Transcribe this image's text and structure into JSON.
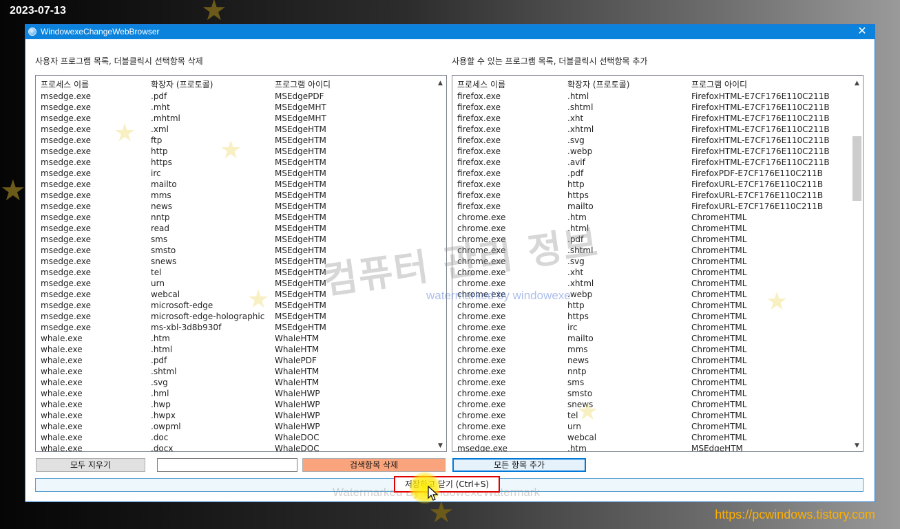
{
  "desktop": {
    "date": "2023-07-13",
    "blog_url": "https://pcwindows.tistory.com"
  },
  "window": {
    "title": "WindowexeChangeWebBrowser",
    "close_glyph": "✕"
  },
  "left_panel": {
    "label": "사용자 프로그램 목록, 더블클릭시 선택항목 삭제",
    "headers": [
      "프로세스 이름",
      "확장자 (프로토콜)",
      "프로그램 아이디"
    ],
    "rows": [
      [
        "msedge.exe",
        ".pdf",
        "MSEdgePDF"
      ],
      [
        "msedge.exe",
        ".mht",
        "MSEdgeMHT"
      ],
      [
        "msedge.exe",
        ".mhtml",
        "MSEdgeMHT"
      ],
      [
        "msedge.exe",
        ".xml",
        "MSEdgeHTM"
      ],
      [
        "msedge.exe",
        "ftp",
        "MSEdgeHTM"
      ],
      [
        "msedge.exe",
        "http",
        "MSEdgeHTM"
      ],
      [
        "msedge.exe",
        "https",
        "MSEdgeHTM"
      ],
      [
        "msedge.exe",
        "irc",
        "MSEdgeHTM"
      ],
      [
        "msedge.exe",
        "mailto",
        "MSEdgeHTM"
      ],
      [
        "msedge.exe",
        "mms",
        "MSEdgeHTM"
      ],
      [
        "msedge.exe",
        "news",
        "MSEdgeHTM"
      ],
      [
        "msedge.exe",
        "nntp",
        "MSEdgeHTM"
      ],
      [
        "msedge.exe",
        "read",
        "MSEdgeHTM"
      ],
      [
        "msedge.exe",
        "sms",
        "MSEdgeHTM"
      ],
      [
        "msedge.exe",
        "smsto",
        "MSEdgeHTM"
      ],
      [
        "msedge.exe",
        "snews",
        "MSEdgeHTM"
      ],
      [
        "msedge.exe",
        "tel",
        "MSEdgeHTM"
      ],
      [
        "msedge.exe",
        "urn",
        "MSEdgeHTM"
      ],
      [
        "msedge.exe",
        "webcal",
        "MSEdgeHTM"
      ],
      [
        "msedge.exe",
        "microsoft-edge",
        "MSEdgeHTM"
      ],
      [
        "msedge.exe",
        "microsoft-edge-holographic",
        "MSEdgeHTM"
      ],
      [
        "msedge.exe",
        "ms-xbl-3d8b930f",
        "MSEdgeHTM"
      ],
      [
        "whale.exe",
        ".htm",
        "WhaleHTM"
      ],
      [
        "whale.exe",
        ".html",
        "WhaleHTM"
      ],
      [
        "whale.exe",
        ".pdf",
        "WhalePDF"
      ],
      [
        "whale.exe",
        ".shtml",
        "WhaleHTM"
      ],
      [
        "whale.exe",
        ".svg",
        "WhaleHTM"
      ],
      [
        "whale.exe",
        ".hml",
        "WhaleHWP"
      ],
      [
        "whale.exe",
        ".hwp",
        "WhaleHWP"
      ],
      [
        "whale.exe",
        ".hwpx",
        "WhaleHWP"
      ],
      [
        "whale.exe",
        ".owpml",
        "WhaleHWP"
      ],
      [
        "whale.exe",
        ".doc",
        "WhaleDOC"
      ],
      [
        "whale.exe",
        ".docx",
        "WhaleDOC"
      ]
    ]
  },
  "right_panel": {
    "label": "사용할 수 있는 프로그램 목록, 더블클릭시 선택항목 추가",
    "headers": [
      "프로세스 이름",
      "확장자 (프로토콜)",
      "프로그램 아이디"
    ],
    "rows": [
      [
        "firefox.exe",
        ".html",
        "FirefoxHTML-E7CF176E110C211B"
      ],
      [
        "firefox.exe",
        ".shtml",
        "FirefoxHTML-E7CF176E110C211B"
      ],
      [
        "firefox.exe",
        ".xht",
        "FirefoxHTML-E7CF176E110C211B"
      ],
      [
        "firefox.exe",
        ".xhtml",
        "FirefoxHTML-E7CF176E110C211B"
      ],
      [
        "firefox.exe",
        ".svg",
        "FirefoxHTML-E7CF176E110C211B"
      ],
      [
        "firefox.exe",
        ".webp",
        "FirefoxHTML-E7CF176E110C211B"
      ],
      [
        "firefox.exe",
        ".avif",
        "FirefoxHTML-E7CF176E110C211B"
      ],
      [
        "firefox.exe",
        ".pdf",
        "FirefoxPDF-E7CF176E110C211B"
      ],
      [
        "firefox.exe",
        "http",
        "FirefoxURL-E7CF176E110C211B"
      ],
      [
        "firefox.exe",
        "https",
        "FirefoxURL-E7CF176E110C211B"
      ],
      [
        "firefox.exe",
        "mailto",
        "FirefoxURL-E7CF176E110C211B"
      ],
      [
        "chrome.exe",
        ".htm",
        "ChromeHTML"
      ],
      [
        "chrome.exe",
        ".html",
        "ChromeHTML"
      ],
      [
        "chrome.exe",
        ".pdf",
        "ChromeHTML"
      ],
      [
        "chrome.exe",
        ".shtml",
        "ChromeHTML"
      ],
      [
        "chrome.exe",
        ".svg",
        "ChromeHTML"
      ],
      [
        "chrome.exe",
        ".xht",
        "ChromeHTML"
      ],
      [
        "chrome.exe",
        ".xhtml",
        "ChromeHTML"
      ],
      [
        "chrome.exe",
        ".webp",
        "ChromeHTML"
      ],
      [
        "chrome.exe",
        "http",
        "ChromeHTML"
      ],
      [
        "chrome.exe",
        "https",
        "ChromeHTML"
      ],
      [
        "chrome.exe",
        "irc",
        "ChromeHTML"
      ],
      [
        "chrome.exe",
        "mailto",
        "ChromeHTML"
      ],
      [
        "chrome.exe",
        "mms",
        "ChromeHTML"
      ],
      [
        "chrome.exe",
        "news",
        "ChromeHTML"
      ],
      [
        "chrome.exe",
        "nntp",
        "ChromeHTML"
      ],
      [
        "chrome.exe",
        "sms",
        "ChromeHTML"
      ],
      [
        "chrome.exe",
        "smsto",
        "ChromeHTML"
      ],
      [
        "chrome.exe",
        "snews",
        "ChromeHTML"
      ],
      [
        "chrome.exe",
        "tel",
        "ChromeHTML"
      ],
      [
        "chrome.exe",
        "urn",
        "ChromeHTML"
      ],
      [
        "chrome.exe",
        "webcal",
        "ChromeHTML"
      ],
      [
        "msedge.exe",
        ".htm",
        "MSEdgeHTM"
      ]
    ]
  },
  "controls": {
    "clear_all": "모두 지우기",
    "search_value": "",
    "delete_search": "검색항목 삭제",
    "add_all": "모든 항목 추가",
    "save_close": "저장하고 닫기 (Ctrl+S)"
  },
  "watermarks": {
    "main": "컴퓨터 관리 정보",
    "sub": "watermarked by windowexe",
    "bottom": "Watermarked By WindowexeWatermark"
  },
  "icons": {
    "scroll_up": "▲",
    "scroll_down": "▼",
    "star": "★"
  }
}
